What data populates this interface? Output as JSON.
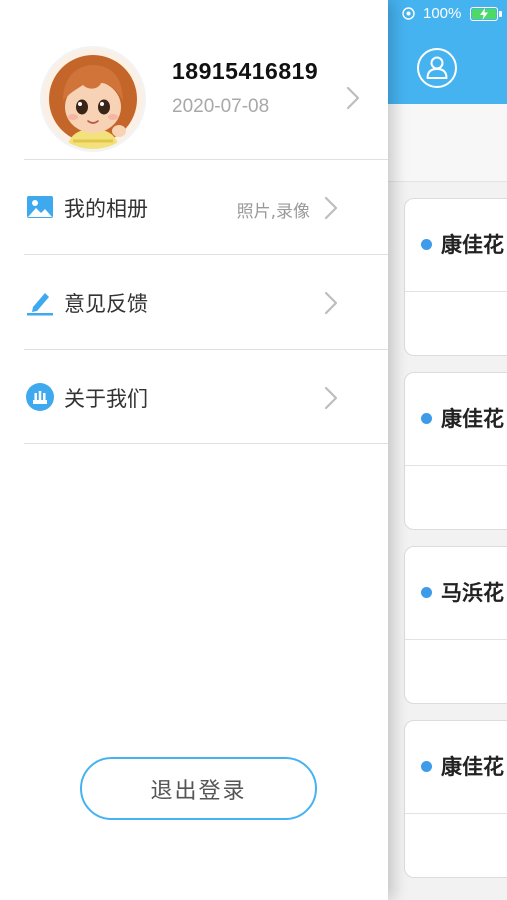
{
  "status_bar": {
    "battery_text": "100%"
  },
  "drawer": {
    "profile": {
      "phone": "18915416819",
      "date": "2020-07-08"
    },
    "menu": [
      {
        "label": "我的相册",
        "value": "照片,录像",
        "icon": "photo-album-icon"
      },
      {
        "label": "意见反馈",
        "value": "",
        "icon": "pencil-icon"
      },
      {
        "label": "关于我们",
        "value": "",
        "icon": "about-icon"
      }
    ],
    "logout_label": "退出登录"
  },
  "background": {
    "cards": [
      {
        "name": "康佳花"
      },
      {
        "name": "康佳花"
      },
      {
        "name": "马浜花"
      },
      {
        "name": "康佳花"
      }
    ]
  },
  "colors": {
    "accent": "#46b3f1",
    "dot": "#3d9be9"
  }
}
